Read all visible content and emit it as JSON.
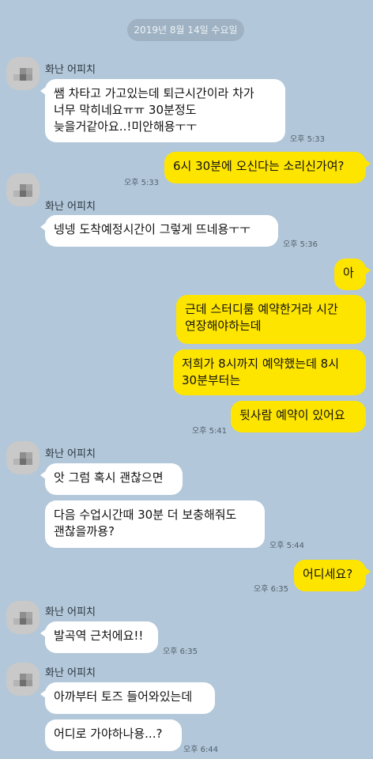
{
  "date": "2019년 8월 14일 수요일",
  "sender_name": "화난 어피치",
  "messages": {
    "m1": "쌤 차타고 가고있는데 퇴근시간이라 차가\n너무 막히네요ㅠㅠ 30분정도\n늦을거같아요..!미안해용ㅜㅜ",
    "t1": "오후 5:33",
    "m2": "6시 30분에 오신다는 소리신가여?",
    "t2": "오후 5:33",
    "m3": "넹넹 도착예정시간이 그렇게 뜨네용ㅜㅜ",
    "t3": "오후 5:36",
    "m4": "아",
    "m5": "근데 스터디룸 예약한거라 시간\n연장해야하는데",
    "m6": "저희가 8시까지 예약했는데 8시\n30분부터는",
    "m7": "뒷사람 예약이 있어요",
    "t4": "오후 5:41",
    "m8": "앗 그럼 혹시 괜찮으면",
    "m9": "다음 수업시간때 30분 더 보충해줘도\n괜찮을까용?",
    "t5": "오후 5:44",
    "m10": "어디세요?",
    "t6": "오후 6:35",
    "m11": "발곡역 근처에요!!",
    "t7": "오후 6:35",
    "m12": "아까부터 토즈 들어와있는데",
    "m13": "어디로 가야하나용...?",
    "t8": "오후 6:44"
  },
  "colors": {
    "background": "#b2c7d9",
    "incoming": "#ffffff",
    "outgoing": "#fee500"
  }
}
